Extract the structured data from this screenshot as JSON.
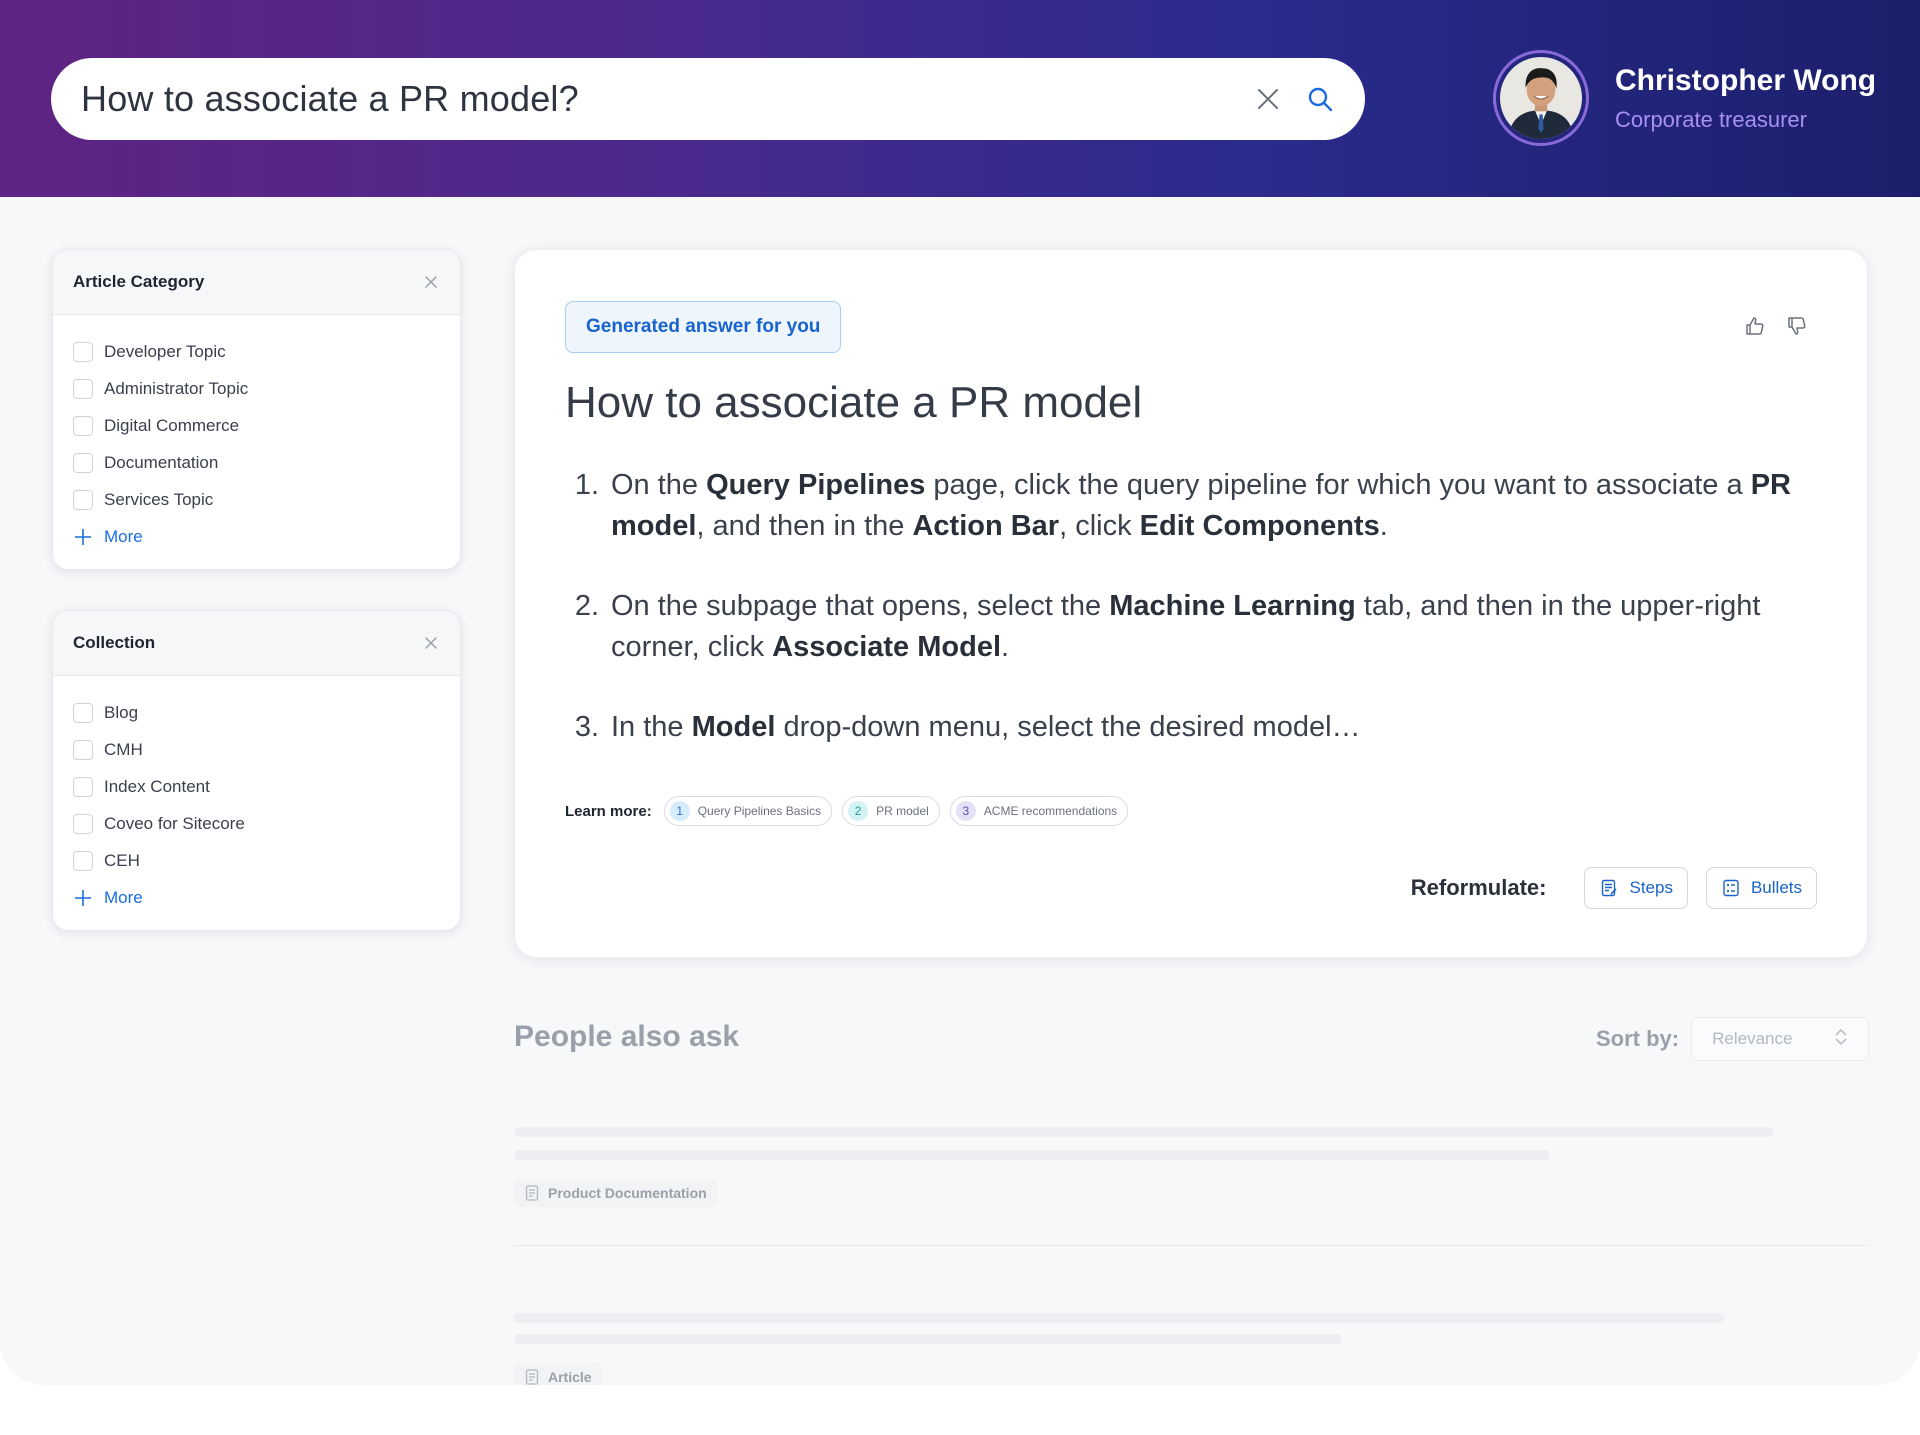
{
  "header": {
    "search": {
      "value": "How to associate a PR model?"
    },
    "user": {
      "name": "Christopher Wong",
      "role": "Corporate treasurer"
    }
  },
  "facets": [
    {
      "title": "Article Category",
      "items": [
        "Developer Topic",
        "Administrator Topic",
        "Digital Commerce",
        "Documentation",
        "Services Topic"
      ],
      "more_label": "More"
    },
    {
      "title": "Collection",
      "items": [
        "Blog",
        "CMH",
        "Index Content",
        "Coveo for Sitecore",
        "CEH"
      ],
      "more_label": "More"
    }
  ],
  "answer": {
    "badge": "Generated answer for you",
    "title": "How to associate a PR model",
    "steps": [
      {
        "num": "1.",
        "parts": [
          {
            "t": "On the "
          },
          {
            "t": "Query Pipelines",
            "b": true
          },
          {
            "t": " page, click the query pipeline for which you want to associate a "
          },
          {
            "t": "PR model",
            "b": true
          },
          {
            "t": ", and then in the "
          },
          {
            "t": "Action Bar",
            "b": true
          },
          {
            "t": ", click "
          },
          {
            "t": "Edit Components",
            "b": true
          },
          {
            "t": "."
          }
        ]
      },
      {
        "num": "2.",
        "parts": [
          {
            "t": "On the subpage that opens, select the "
          },
          {
            "t": "Machine Learning",
            "b": true
          },
          {
            "t": " tab, and then in the upper-right corner, click "
          },
          {
            "t": "Associate Model",
            "b": true
          },
          {
            "t": "."
          }
        ]
      },
      {
        "num": "3.",
        "parts": [
          {
            "t": "In the "
          },
          {
            "t": "Model",
            "b": true
          },
          {
            "t": " drop-down menu, select the desired model…"
          }
        ]
      }
    ],
    "learn_more_label": "Learn more:",
    "sources": [
      {
        "num": "1",
        "label": "Query Pipelines Basics",
        "color": "#d6ebfb",
        "text_color": "#2a78c9"
      },
      {
        "num": "2",
        "label": "PR model",
        "color": "#d3f2f4",
        "text_color": "#1e9aa4"
      },
      {
        "num": "3",
        "label": "ACME recommendations",
        "color": "#e4e1f7",
        "text_color": "#5b4fb3"
      }
    ],
    "reformulate_label": "Reformulate:",
    "reformulate_options": [
      "Steps",
      "Bullets"
    ]
  },
  "people_also_ask": {
    "title": "People also ask",
    "sort_label": "Sort by:",
    "sort_value": "Relevance",
    "results": [
      {
        "tag": "Product Documentation"
      },
      {
        "tag": "Article"
      }
    ]
  },
  "colors": {
    "header_gradient_start": "#5f2383",
    "header_gradient_end": "#1b1f6b",
    "accent": "#1a6de0",
    "role_text": "#a98ff0"
  }
}
